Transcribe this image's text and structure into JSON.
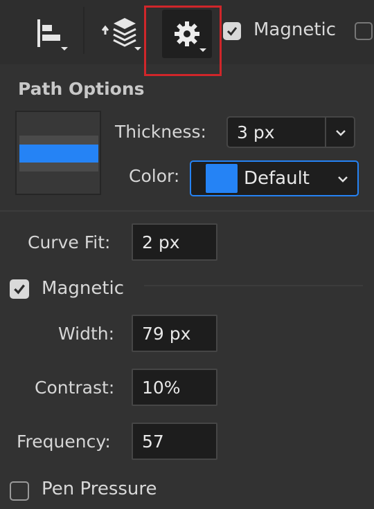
{
  "toolbar": {
    "align_icon": "align-left-icon",
    "layers_icon": "layers-arrange-icon",
    "gear_icon": "gear-icon",
    "magnetic_label": "Magnetic",
    "magnetic_checked": true
  },
  "path_options": {
    "title": "Path Options",
    "thickness_label": "Thickness:",
    "thickness_value": "3 px",
    "color_label": "Color:",
    "color_value": "Default",
    "color_swatch": "#2583f5",
    "preview_line_color": "#2583f5"
  },
  "settings": {
    "curve_fit_label": "Curve Fit:",
    "curve_fit_value": "2 px",
    "magnetic_label": "Magnetic",
    "magnetic_checked": true,
    "width_label": "Width:",
    "width_value": "79 px",
    "contrast_label": "Contrast:",
    "contrast_value": "10%",
    "frequency_label": "Frequency:",
    "frequency_value": "57",
    "pen_pressure_label": "Pen Pressure",
    "pen_pressure_checked": false
  },
  "colors": {
    "accent": "#2583f5",
    "highlight": "#d0262a",
    "panel": "#323232"
  }
}
